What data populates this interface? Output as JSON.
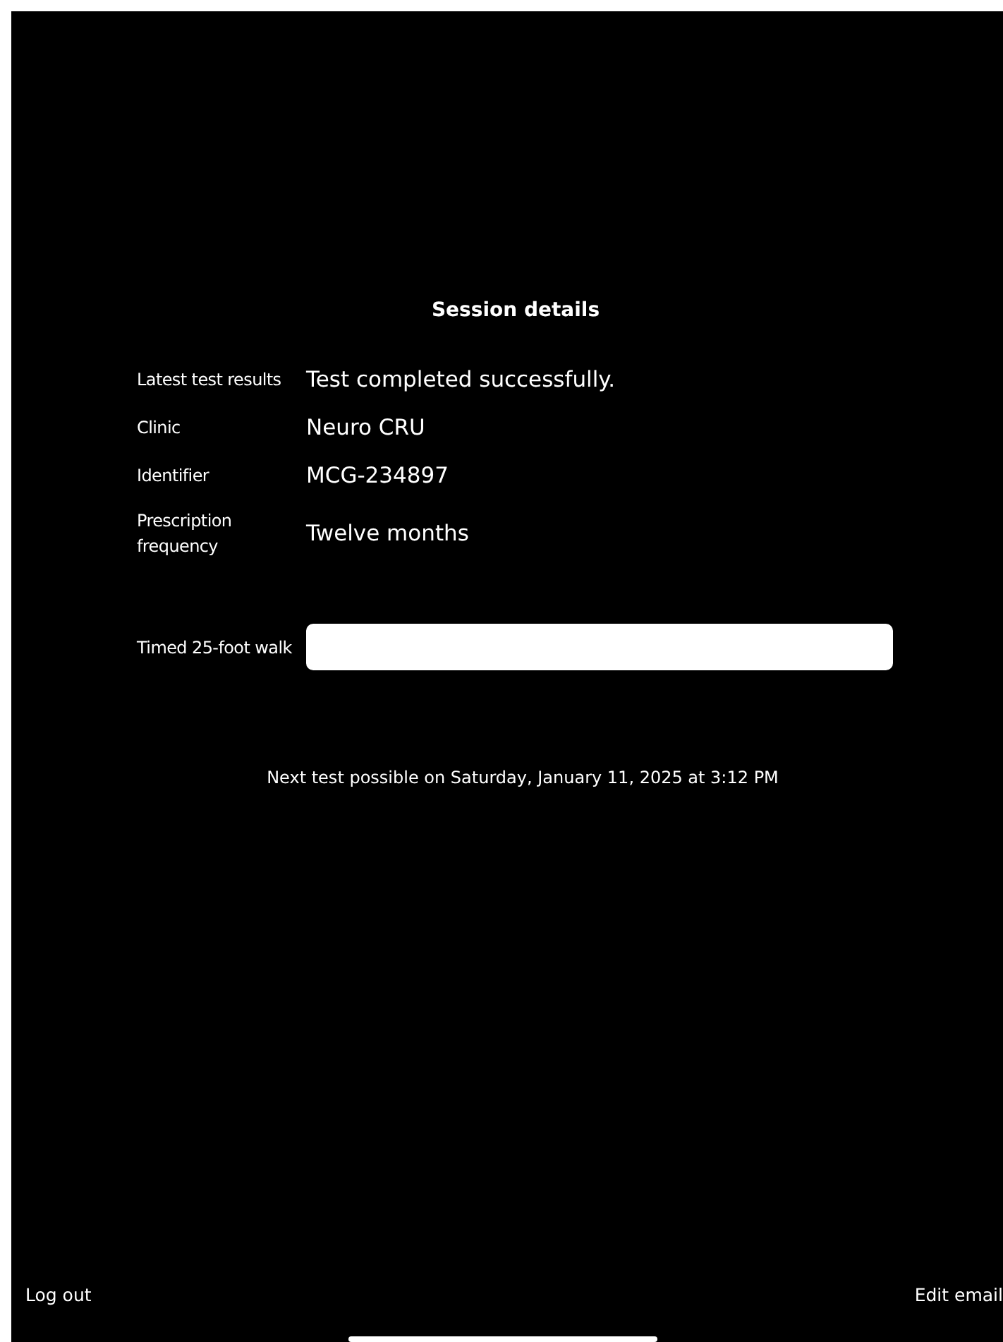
{
  "title": "Session details",
  "details": [
    {
      "label": "Latest test results",
      "value": "Test completed successfully."
    },
    {
      "label": "Clinic",
      "value": "Neuro CRU"
    },
    {
      "label": "Identifier",
      "value": "MCG-234897"
    },
    {
      "label": "Prescription frequency",
      "value": "Twelve months"
    }
  ],
  "walk_field": {
    "label": "Timed 25-foot walk"
  },
  "next_test": "Next test possible on Saturday, January 11, 2025 at 3:12 PM",
  "footer": {
    "left_link": "Log out",
    "right_link": "Edit email"
  }
}
